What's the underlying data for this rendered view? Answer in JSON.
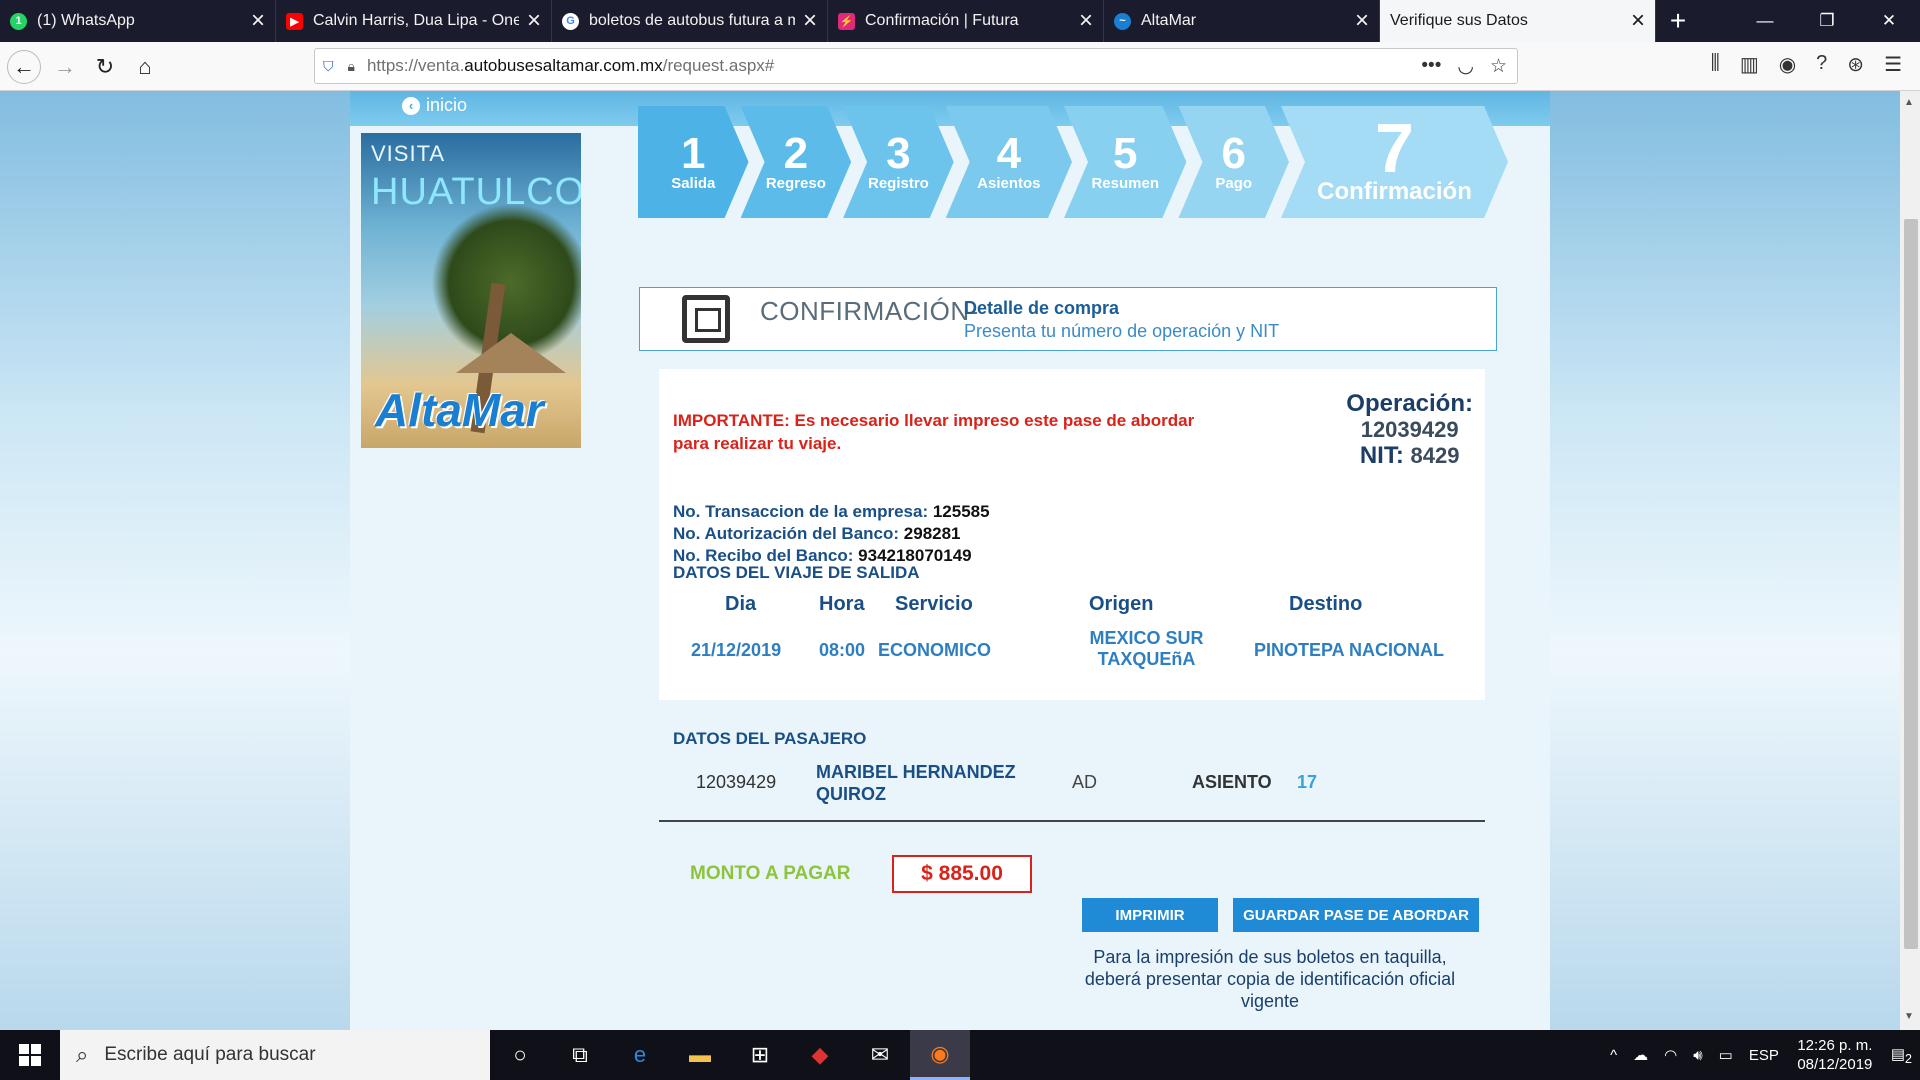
{
  "browser": {
    "tabs": [
      {
        "title": "(1) WhatsApp",
        "icon": "whatsapp-icon",
        "color": "#25d366",
        "glyph": "1"
      },
      {
        "title": "Calvin Harris, Dua Lipa - One K",
        "icon": "youtube-icon",
        "color": "#ff0000",
        "glyph": "▶"
      },
      {
        "title": "boletos de autobus futura a m",
        "icon": "google-icon",
        "color": "#4285f4",
        "glyph": "G"
      },
      {
        "title": "Confirmación | Futura",
        "icon": "futura-icon",
        "color": "#e0297a",
        "glyph": "⚡"
      },
      {
        "title": "AltaMar",
        "icon": "altamar-icon",
        "color": "#1a7ed1",
        "glyph": "~"
      },
      {
        "title": "Verifique sus Datos",
        "icon": "",
        "color": "",
        "glyph": ""
      }
    ],
    "url_prefix": "https://venta.",
    "url_domain": "autobusesaltamar.com.mx",
    "url_path": "/request.aspx#"
  },
  "page": {
    "inicio": "inicio",
    "promo": {
      "visita": "VISITA",
      "place": "HUATULCO",
      "logo": "AltaMar"
    },
    "steps": [
      {
        "num": "1",
        "label": "Salida",
        "color": "#4db3e6"
      },
      {
        "num": "2",
        "label": "Regreso",
        "color": "#5dbbe9"
      },
      {
        "num": "3",
        "label": "Registro",
        "color": "#6cc3ec"
      },
      {
        "num": "4",
        "label": "Asientos",
        "color": "#7bcaee"
      },
      {
        "num": "5",
        "label": "Resumen",
        "color": "#88d0f0"
      },
      {
        "num": "6",
        "label": "Pago",
        "color": "#95d5f2"
      },
      {
        "num": "7",
        "label": "Confirmación",
        "color": "#a3dcf4"
      }
    ],
    "confirm_header": {
      "title": "CONFIRMACIÓN-",
      "subtitle": "Detalle de compra",
      "hint": "Presenta tu número de operación y NIT"
    },
    "important_label": "IMPORTANTE:",
    "important_text": "Es necesario llevar impreso este pase de abordar para realizar tu viaje.",
    "operacion_label": "Operación:",
    "operacion_value": "12039429",
    "nit_label": "NIT:",
    "nit_value": "8429",
    "transaccion_label": "No. Transaccion de la empresa:",
    "transaccion_value": "125585",
    "autorizacion_label": "No. Autorización del Banco:",
    "autorizacion_value": "298281",
    "recibo_label": "No. Recibo del Banco:",
    "recibo_value": "934218070149",
    "trip_title": "DATOS DEL VIAJE DE SALIDA",
    "trip_headers": {
      "dia": "Dia",
      "hora": "Hora",
      "servicio": "Servicio",
      "origen": "Origen",
      "destino": "Destino"
    },
    "trip_row": {
      "dia": "21/12/2019",
      "hora": "08:00",
      "servicio": "ECONOMICO",
      "origen": "MEXICO SUR TAXQUEñA",
      "destino": "PINOTEPA NACIONAL"
    },
    "passenger_title": "DATOS DEL PASAJERO",
    "passenger": {
      "id": "12039429",
      "name": "MARIBEL HERNANDEZ QUIROZ",
      "type": "AD",
      "seat_label": "ASIENTO",
      "seat": "17"
    },
    "monto_label": "MONTO A PAGAR",
    "monto_value": "$ 885.00",
    "print_button": "IMPRIMIR",
    "save_button": "GUARDAR PASE DE ABORDAR",
    "note": "Para la impresión de sus boletos en taquilla, deberá presentar copia de identificación oficial vigente"
  },
  "taskbar": {
    "search_placeholder": "Escribe aquí para buscar",
    "lang": "ESP",
    "time": "12:26 p. m.",
    "date": "08/12/2019",
    "notifications": "2"
  }
}
